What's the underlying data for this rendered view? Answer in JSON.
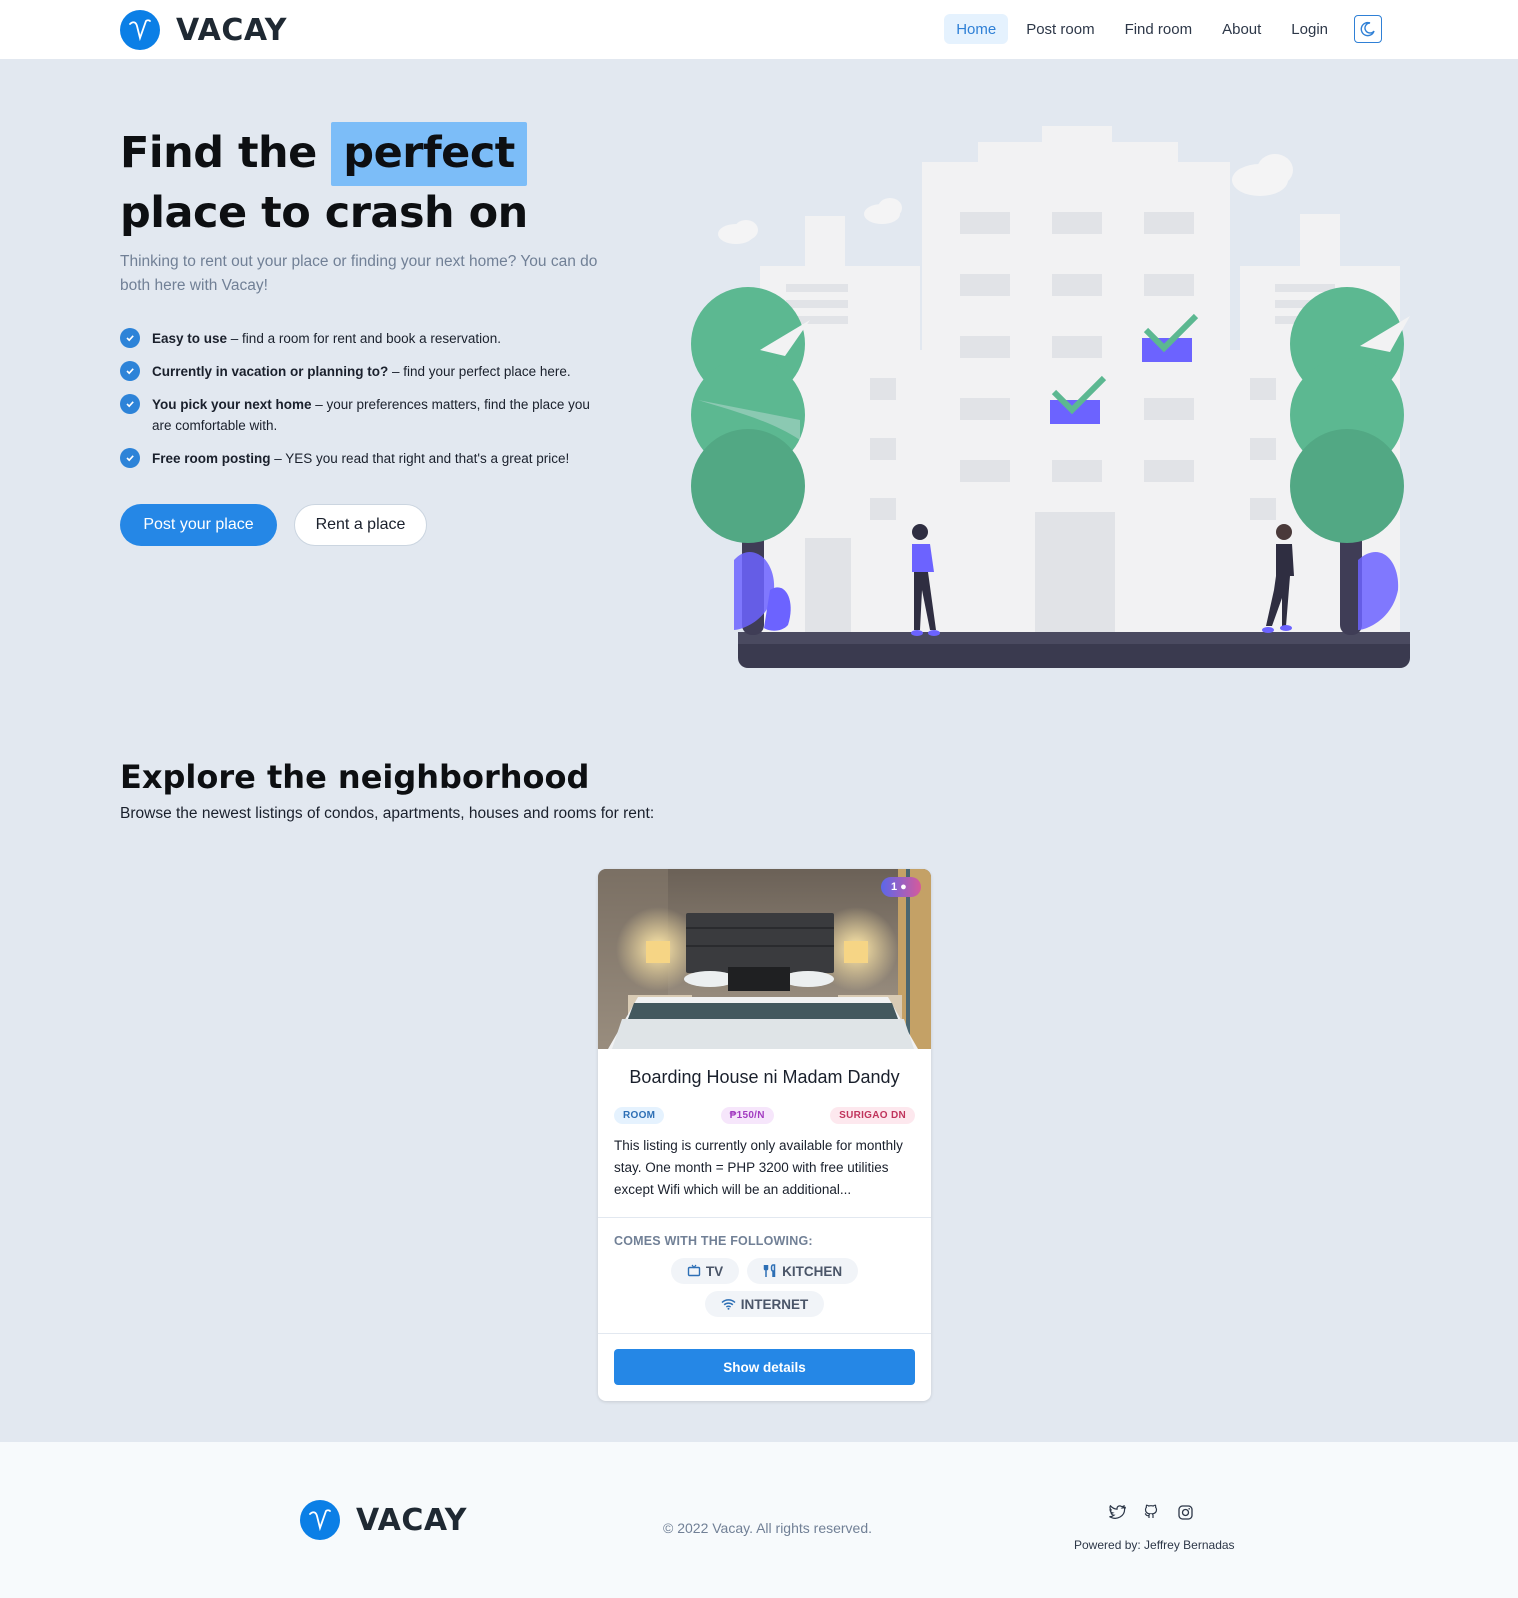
{
  "brand": {
    "name": "VACAY",
    "logo_icon": "v-logo-icon"
  },
  "nav": {
    "items": [
      {
        "label": "Home",
        "active": true
      },
      {
        "label": "Post room",
        "active": false
      },
      {
        "label": "Find room",
        "active": false
      },
      {
        "label": "About",
        "active": false
      },
      {
        "label": "Login",
        "active": false
      }
    ],
    "theme_toggle_icon": "moon-icon"
  },
  "hero": {
    "title_prefix": "Find the",
    "title_highlight": "perfect",
    "title_line2": "place to crash on",
    "subtitle": "Thinking to rent out your place or finding your next home? You can do both here with Vacay!",
    "features": [
      {
        "bold": "Easy to use",
        "text": " – find a room for rent and book a reservation."
      },
      {
        "bold": "Currently in vacation or planning to?",
        "text": " – find your perfect place here."
      },
      {
        "bold": "You pick your next home",
        "text": " – your preferences matters, find the place you are comfortable with."
      },
      {
        "bold": "Free room posting",
        "text": " – YES you read that right and that's a great price!"
      }
    ],
    "primary_button": "Post your place",
    "secondary_button": "Rent a place",
    "highlight_color": "#7cbdf8",
    "accent_color": "#2587e6"
  },
  "explore": {
    "title": "Explore the neighborhood",
    "subtitle": "Browse the newest listings of condos, apartments, houses and rooms for rent:"
  },
  "listing": {
    "count_badge": "1",
    "title": "Boarding House ni Madam Dandy",
    "tags": {
      "type": "ROOM",
      "price": "₱150/N",
      "location": "SURIGAO DN"
    },
    "description": "This listing is currently only available for monthly stay. One month = PHP 3200 with free utilities except Wifi which will be an additional...",
    "amenities_title": "COMES WITH THE FOLLOWING:",
    "amenities": [
      "TV",
      "KITCHEN",
      "INTERNET"
    ],
    "button": "Show details"
  },
  "footer": {
    "brand": "VACAY",
    "copyright": "© 2022 Vacay. All rights reserved.",
    "social_icons": [
      "twitter-icon",
      "github-icon",
      "instagram-icon"
    ],
    "powered_by": "Powered by: Jeffrey Bernadas"
  }
}
